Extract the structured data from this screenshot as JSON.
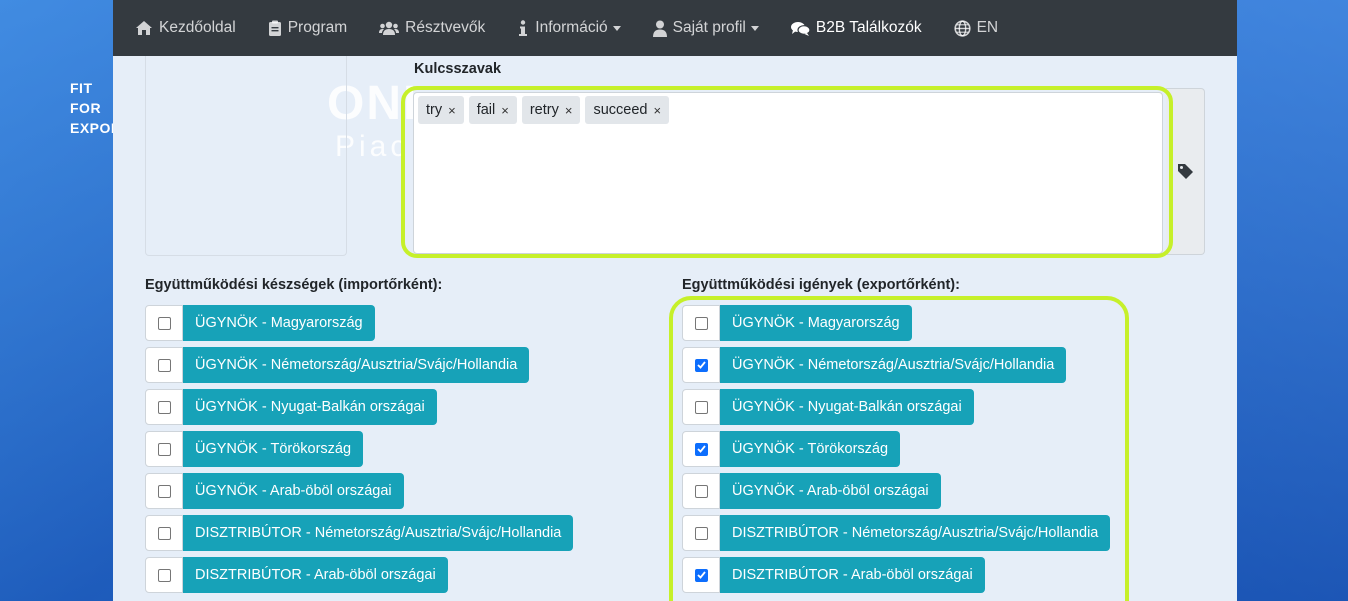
{
  "brand": {
    "line1": "FIT",
    "line2": "FOR",
    "line3": "EXPORT"
  },
  "nav": [
    {
      "label": "Kezdőoldal",
      "icon": "home-icon"
    },
    {
      "label": "Program",
      "icon": "clipboard-icon"
    },
    {
      "label": "Résztvevők",
      "icon": "users-icon"
    },
    {
      "label": "Információ",
      "icon": "info-icon",
      "dropdown": true
    },
    {
      "label": "Saját profil",
      "icon": "user-icon",
      "dropdown": true
    },
    {
      "label": "B2B Találkozók",
      "icon": "comments-icon",
      "active": true
    },
    {
      "label": "EN",
      "icon": "globe-icon"
    }
  ],
  "hero": {
    "title": "ONL",
    "subtitle": "Piac"
  },
  "keywords": {
    "label": "Kulcsszavak",
    "tags": [
      "try",
      "fail",
      "retry",
      "succeed"
    ],
    "remove_symbol": "×",
    "addon_icon": "tag-icon"
  },
  "left_column": {
    "label": "Együttműködési készségek (importőrként):",
    "items": [
      {
        "label": "ÜGYNÖK - Magyarország",
        "checked": false
      },
      {
        "label": "ÜGYNÖK - Németország/Ausztria/Svájc/Hollandia",
        "checked": false
      },
      {
        "label": "ÜGYNÖK - Nyugat-Balkán országai",
        "checked": false
      },
      {
        "label": "ÜGYNÖK - Törökország",
        "checked": false
      },
      {
        "label": "ÜGYNÖK - Arab-öböl országai",
        "checked": false
      },
      {
        "label": "DISZTRIBÚTOR - Németország/Ausztria/Svájc/Hollandia",
        "checked": false
      },
      {
        "label": "DISZTRIBÚTOR - Arab-öböl országai",
        "checked": false
      }
    ]
  },
  "right_column": {
    "label": "Együttműködési igények (exportőrként):",
    "items": [
      {
        "label": "ÜGYNÖK - Magyarország",
        "checked": false
      },
      {
        "label": "ÜGYNÖK - Németország/Ausztria/Svájc/Hollandia",
        "checked": true
      },
      {
        "label": "ÜGYNÖK - Nyugat-Balkán országai",
        "checked": false
      },
      {
        "label": "ÜGYNÖK - Törökország",
        "checked": true
      },
      {
        "label": "ÜGYNÖK - Arab-öböl országai",
        "checked": false
      },
      {
        "label": "DISZTRIBÚTOR - Németország/Ausztria/Svájc/Hollandia",
        "checked": false
      },
      {
        "label": "DISZTRIBÚTOR - Arab-öböl országai",
        "checked": true
      }
    ]
  },
  "colors": {
    "navbar": "#343a40",
    "label_bg": "#17a2b8",
    "highlight": "#c6f02a",
    "check": "#0d6efd"
  }
}
